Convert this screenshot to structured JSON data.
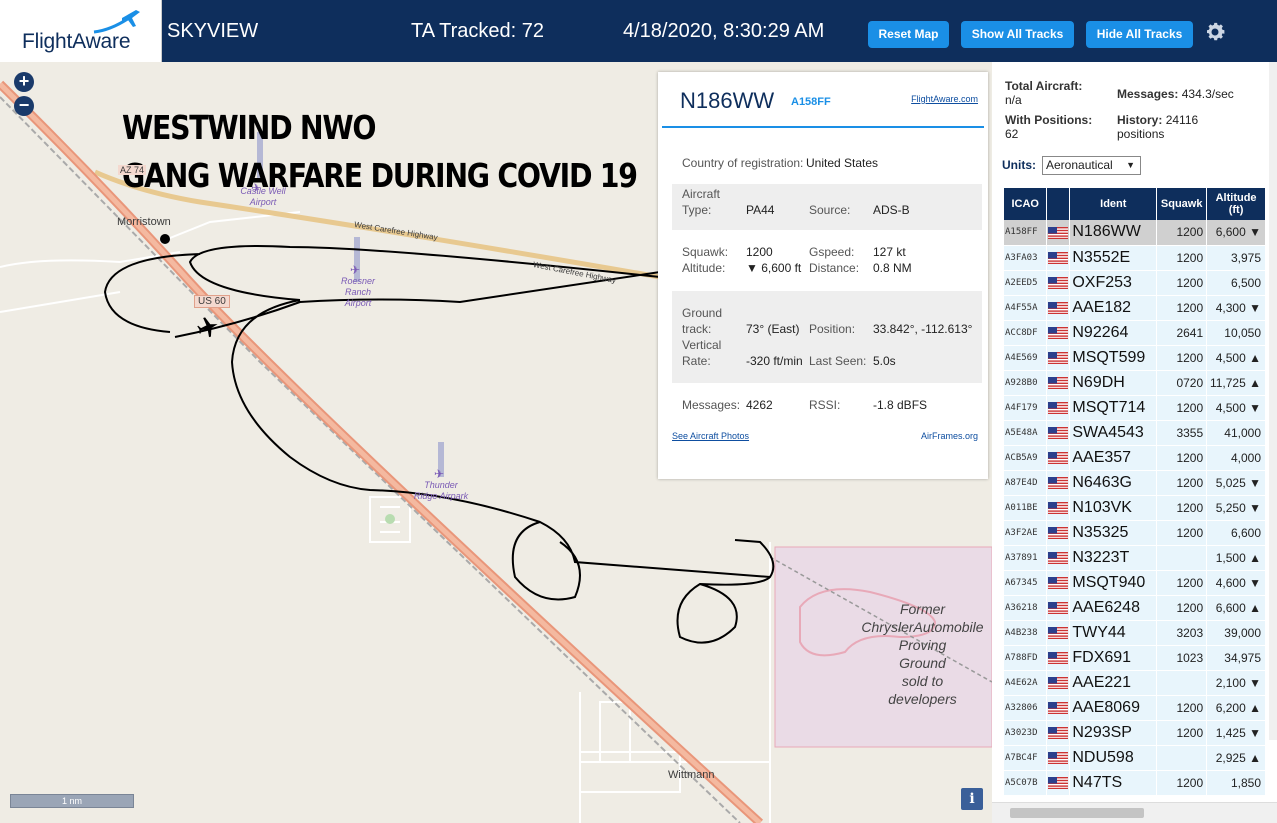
{
  "header": {
    "logo": "FlightAware",
    "title": "SKYVIEW",
    "tracked": "TA Tracked: 72",
    "datetime": "4/18/2020, 8:30:29 AM",
    "reset_label": "Reset Map",
    "show_all_label": "Show All Tracks",
    "hide_all_label": "Hide All Tracks"
  },
  "overlay": {
    "line1": "WESTWIND NWO",
    "line2": "GANG WARFARE DURING COVID 19"
  },
  "map": {
    "zoom_in": "+",
    "zoom_out": "−",
    "scale": "1 nm",
    "info": "i",
    "labels": {
      "morristown": "Morristown",
      "us60": "US 60",
      "highway1": "West Carefree Highway",
      "highway2": "West Carefree Highway",
      "castle_well": "Castle Well",
      "castle_well_airport": "Airport",
      "roesner1": "Roesner",
      "roesner2": "Ranch",
      "roesner3": "Airport",
      "thunder1": "Thunder",
      "thunder2": "Ridge Airpark",
      "wittmann": "Wittmann",
      "chrysler1": "Former",
      "chrysler2": "ChryslerAutomobile",
      "chrysler3": "Proving",
      "chrysler4": "Ground",
      "chrysler5": "sold to",
      "chrysler6": "developers",
      "us74": "AZ 74"
    }
  },
  "popup": {
    "ident": "N186WW",
    "hex": "A158FF",
    "fa_link": "FlightAware.com",
    "country_label": "Country of registration:",
    "country_value": "United States",
    "aircraft_label": "Aircraft",
    "type_label": "Type:",
    "type_value": "PA44",
    "source_label": "Source:",
    "source_value": "ADS-B",
    "squawk_label": "Squawk:",
    "squawk_value": "1200",
    "gspeed_label": "Gspeed:",
    "gspeed_value": "127 kt",
    "altitude_label": "Altitude:",
    "altitude_value": "▼ 6,600 ft",
    "distance_label": "Distance:",
    "distance_value": "0.8 NM",
    "ground_label": "Ground",
    "track_label": "track:",
    "track_value": "73° (East)",
    "position_label": "Position:",
    "position_value": "33.842°, -112.613°",
    "vertical_label": "Vertical",
    "rate_label": "Rate:",
    "rate_value": "-320 ft/min",
    "lastseen_label": "Last Seen:",
    "lastseen_value": "5.0s",
    "messages_label": "Messages:",
    "messages_value": "4262",
    "rssi_label": "RSSI:",
    "rssi_value": "-1.8 dBFS",
    "photos_link": "See Aircraft Photos",
    "airframes_link": "AirFrames.org"
  },
  "panel": {
    "total_label": "Total Aircraft:",
    "total_value": "n/a",
    "messages_label": "Messages:",
    "messages_value": "434.3/sec",
    "withpos_label": "With Positions:",
    "withpos_value": "62",
    "history_label": "History:",
    "history_value": "24116",
    "history_unit": "positions",
    "units_label": "Units:",
    "units_value": "Aeronautical",
    "columns": [
      "ICAO",
      "",
      "Ident",
      "Squawk",
      "Altitude (ft)"
    ],
    "rows": [
      {
        "icao": "A158FF",
        "ident": "N186WW",
        "squawk": "1200",
        "alt": "6,600 ▼"
      },
      {
        "icao": "A3FA03",
        "ident": "N3552E",
        "squawk": "1200",
        "alt": "3,975"
      },
      {
        "icao": "A2EED5",
        "ident": "OXF253",
        "squawk": "1200",
        "alt": "6,500"
      },
      {
        "icao": "A4F55A",
        "ident": "AAE182",
        "squawk": "1200",
        "alt": "4,300 ▼"
      },
      {
        "icao": "ACC8DF",
        "ident": "N92264",
        "squawk": "2641",
        "alt": "10,050"
      },
      {
        "icao": "A4E569",
        "ident": "MSQT599",
        "squawk": "1200",
        "alt": "4,500 ▲"
      },
      {
        "icao": "A928B0",
        "ident": "N69DH",
        "squawk": "0720",
        "alt": "11,725 ▲"
      },
      {
        "icao": "A4F179",
        "ident": "MSQT714",
        "squawk": "1200",
        "alt": "4,500 ▼"
      },
      {
        "icao": "A5E48A",
        "ident": "SWA4543",
        "squawk": "3355",
        "alt": "41,000"
      },
      {
        "icao": "ACB5A9",
        "ident": "AAE357",
        "squawk": "1200",
        "alt": "4,000"
      },
      {
        "icao": "A87E4D",
        "ident": "N6463G",
        "squawk": "1200",
        "alt": "5,025 ▼"
      },
      {
        "icao": "A011BE",
        "ident": "N103VK",
        "squawk": "1200",
        "alt": "5,250 ▼"
      },
      {
        "icao": "A3F2AE",
        "ident": "N35325",
        "squawk": "1200",
        "alt": "6,600"
      },
      {
        "icao": "A37891",
        "ident": "N3223T",
        "squawk": "",
        "alt": "1,500 ▲"
      },
      {
        "icao": "A67345",
        "ident": "MSQT940",
        "squawk": "1200",
        "alt": "4,600 ▼"
      },
      {
        "icao": "A36218",
        "ident": "AAE6248",
        "squawk": "1200",
        "alt": "6,600 ▲"
      },
      {
        "icao": "A4B238",
        "ident": "TWY44",
        "squawk": "3203",
        "alt": "39,000"
      },
      {
        "icao": "A788FD",
        "ident": "FDX691",
        "squawk": "1023",
        "alt": "34,975"
      },
      {
        "icao": "A4E62A",
        "ident": "AAE221",
        "squawk": "",
        "alt": "2,100 ▼"
      },
      {
        "icao": "A32806",
        "ident": "AAE8069",
        "squawk": "1200",
        "alt": "6,200 ▲"
      },
      {
        "icao": "A3023D",
        "ident": "N293SP",
        "squawk": "1200",
        "alt": "1,425 ▼"
      },
      {
        "icao": "A7BC4F",
        "ident": "NDU598",
        "squawk": "",
        "alt": "2,925 ▲"
      },
      {
        "icao": "A5C07B",
        "ident": "N47TS",
        "squawk": "1200",
        "alt": "1,850"
      }
    ]
  }
}
